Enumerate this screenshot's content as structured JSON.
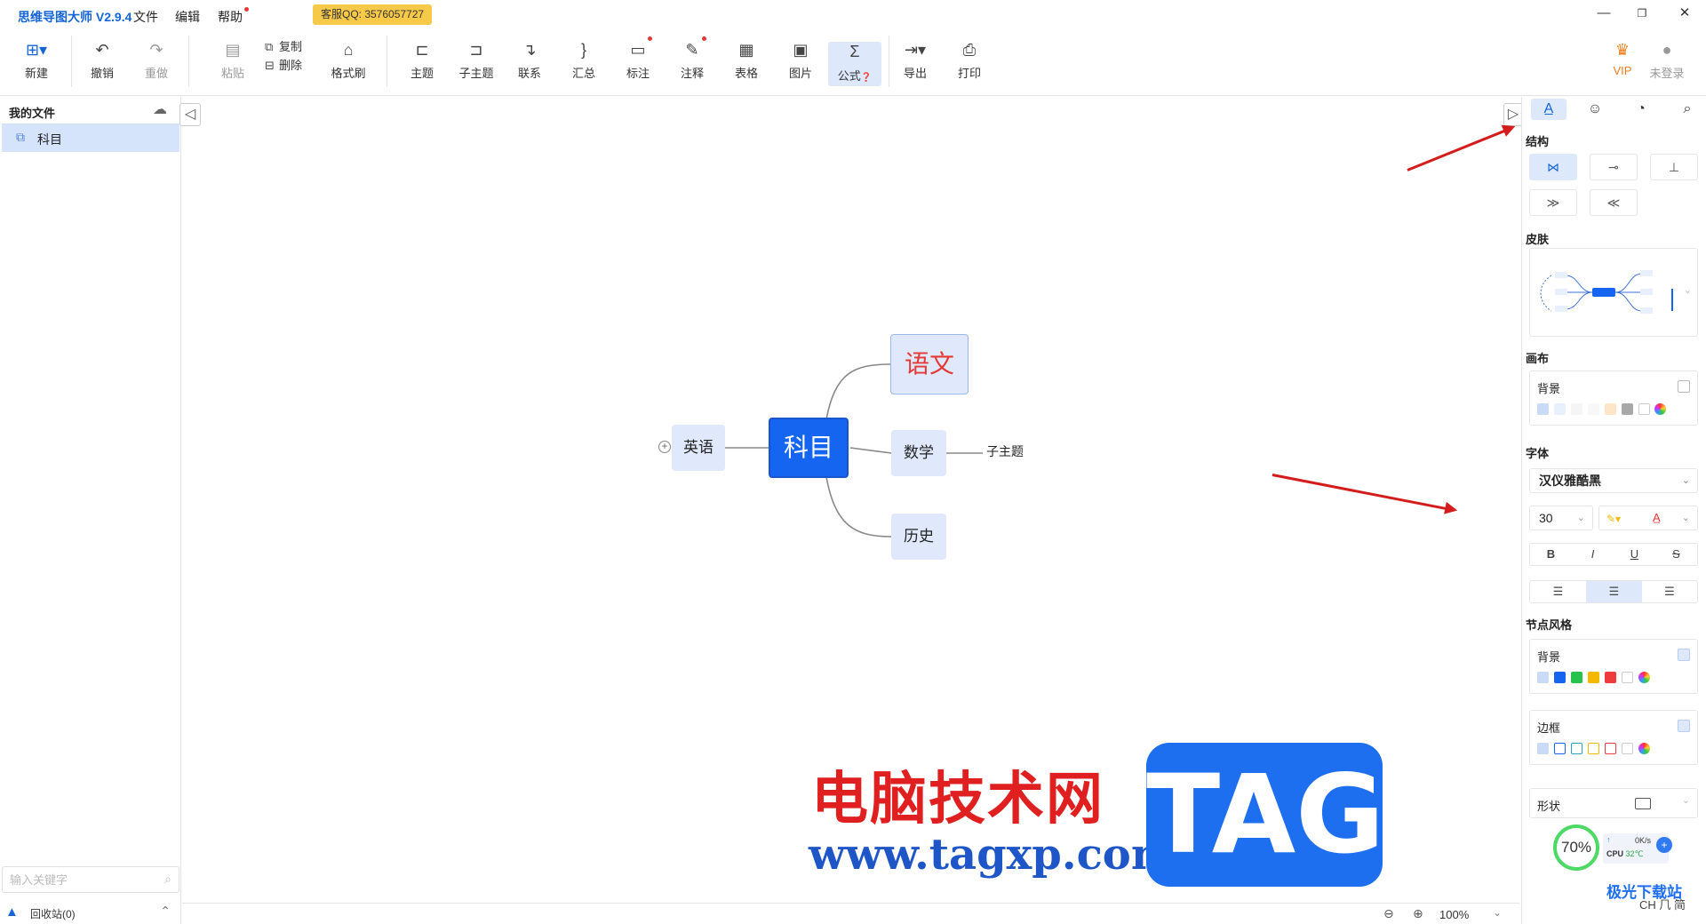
{
  "app": {
    "title": "思维导图大师 V2.9.4"
  },
  "menu": {
    "items": [
      "文件",
      "编辑",
      "帮助"
    ],
    "qq": "客服QQ: 3576057727"
  },
  "window": {
    "minimize": "—",
    "restore": "❐",
    "close": "✕"
  },
  "toolbar": {
    "new": "新建",
    "undo": "撤销",
    "redo": "重做",
    "paste": "粘贴",
    "copy": "复制",
    "delete": "删除",
    "format_brush": "格式刷",
    "topic": "主题",
    "subtopic": "子主题",
    "relation": "联系",
    "summary": "汇总",
    "mark": "标注",
    "note": "注释",
    "table": "表格",
    "image": "图片",
    "formula": "公式",
    "export": "导出",
    "print": "打印",
    "vip": "VIP",
    "login": "未登录"
  },
  "sidebar": {
    "title": "我的文件",
    "files": [
      {
        "name": "科目"
      }
    ],
    "search_placeholder": "输入关键字",
    "recycle": "回收站(0)"
  },
  "mindmap": {
    "root": "科目",
    "nodes": {
      "yuwen": "语文",
      "shuxue": "数学",
      "lishi": "历史",
      "yingyu": "英语",
      "zizhuti": "子主题"
    },
    "expand": "+"
  },
  "status": {
    "zoom": "100%",
    "zoom_out": "−",
    "zoom_in": "+"
  },
  "panel": {
    "tabs": [
      "style",
      "emoji",
      "theme",
      "search"
    ],
    "structure": "结构",
    "skin": "皮肤",
    "canvas": "画布",
    "background": "背景",
    "font": "字体",
    "font_name": "汉仪雅酷黑",
    "font_size": "30",
    "bold": "B",
    "italic": "I",
    "underline": "U",
    "strike": "S",
    "node_style": "节点风格",
    "node_background": "背景",
    "border": "边框",
    "shape": "形状",
    "canvas_colors": [
      "#e8f0fd",
      "#f5f5f5",
      "#f7f7f7",
      "#fce6c7",
      "#a8a8a8"
    ],
    "node_colors": [
      "#1565f0",
      "#27c24c",
      "#f5b800",
      "#ee3b3b"
    ],
    "border_colors": [
      "#1565f0",
      "#27a0c2",
      "#f5b800",
      "#ee3b3b"
    ]
  },
  "watermark": {
    "cn": "电脑技术网",
    "url": "www.tagxp.com",
    "tag": "TAG"
  },
  "monitor": {
    "cpu_percent": "70%",
    "net": "0K/s",
    "cpu_label": "CPU",
    "temp": "32℃",
    "brand": "极光下载站",
    "ime": "CH ⺇ 简"
  }
}
